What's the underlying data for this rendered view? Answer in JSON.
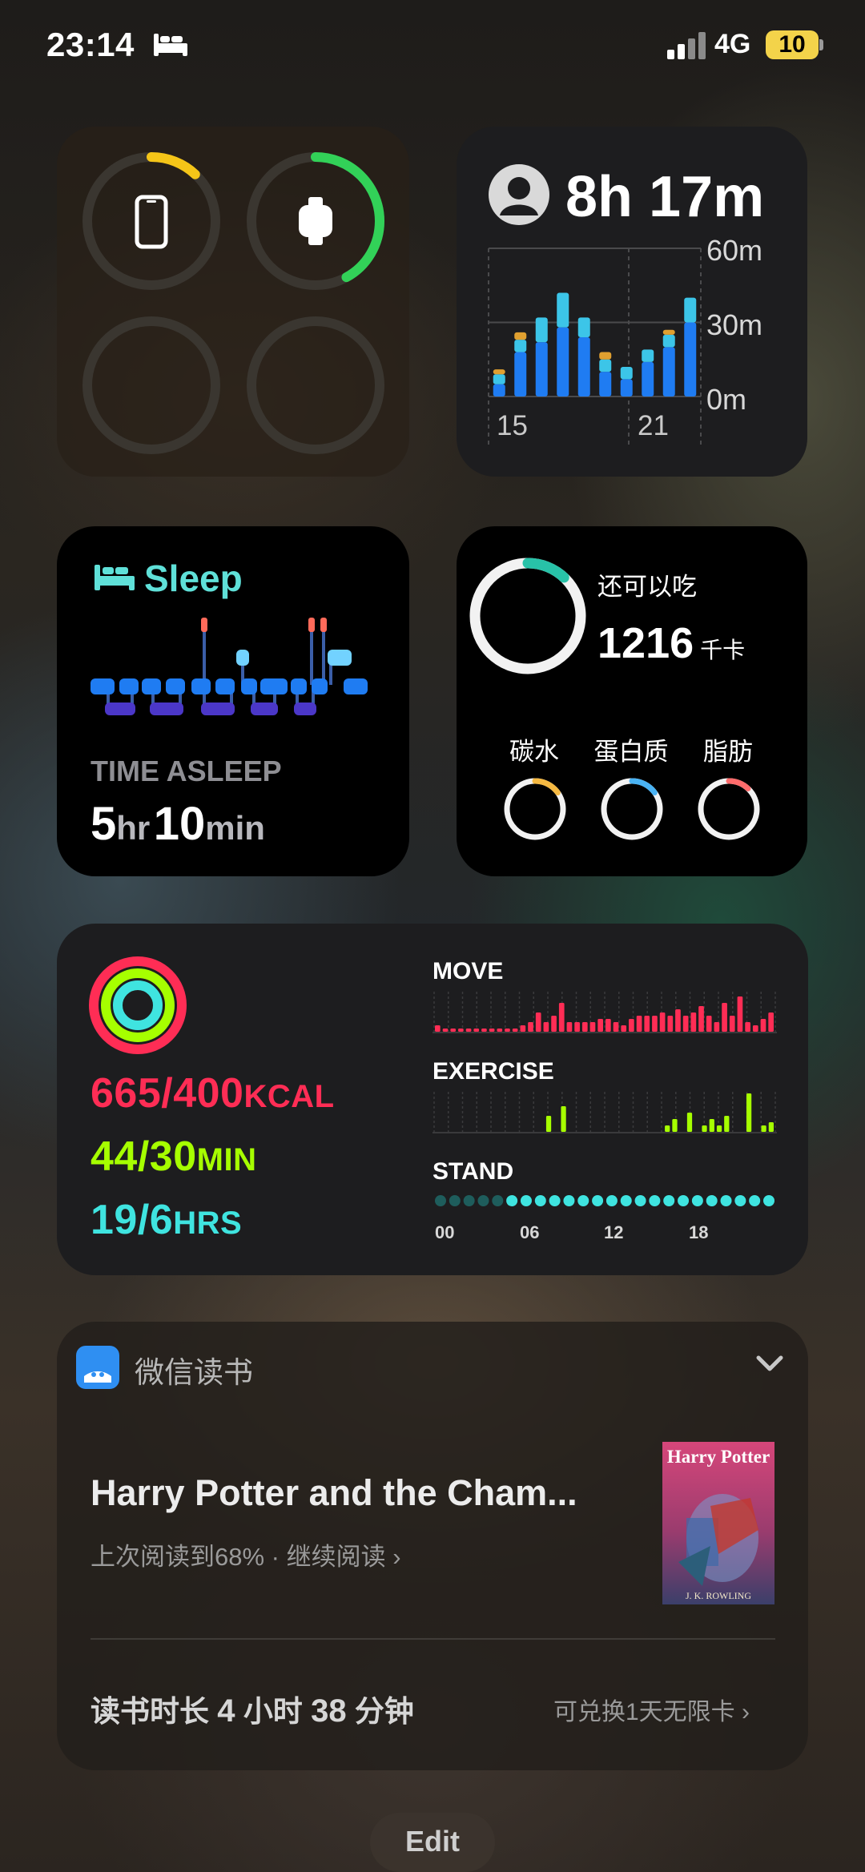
{
  "status_bar": {
    "time": "23:14",
    "network": "4G",
    "battery": "10",
    "sleep_focus_icon": "bed-icon"
  },
  "batteries_widget": {
    "devices": [
      {
        "name": "phone-icon",
        "level": 0.12,
        "color": "#f5c518"
      },
      {
        "name": "watch-icon",
        "level": 0.42,
        "color": "#32d158"
      },
      {
        "name": "empty",
        "level": 0
      },
      {
        "name": "empty",
        "level": 0
      }
    ]
  },
  "screen_time_widget": {
    "total": "8h 17m",
    "y_ticks": [
      "60m",
      "30m",
      "0m"
    ],
    "x_ticks": [
      "15",
      "21"
    ],
    "chart_data": {
      "type": "bar",
      "ylim": [
        0,
        60
      ],
      "series": [
        {
          "values": [
            5,
            18,
            22,
            28,
            24,
            10,
            7,
            14,
            20,
            30
          ]
        },
        {
          "values": [
            4,
            5,
            10,
            14,
            8,
            5,
            5,
            5,
            5,
            10
          ]
        },
        {
          "values": [
            2,
            3,
            0,
            0,
            0,
            3,
            0,
            0,
            2,
            0
          ]
        }
      ],
      "colors": [
        "#1f7cf2",
        "#3cc5e8",
        "#e0a030"
      ]
    }
  },
  "sleep_widget": {
    "title": "Sleep",
    "label": "TIME ASLEEP",
    "hours": "5",
    "hours_unit": "hr",
    "minutes": "10",
    "minutes_unit": "min",
    "stage_colors": {
      "awake": "#ff6a5a",
      "rem": "#72d2ff",
      "core": "#1f7cf2",
      "deep": "#4b37c8"
    }
  },
  "calorie_widget": {
    "label": "还可以吃",
    "value": "1216",
    "unit": "千卡",
    "ring_progress": 0.12,
    "macros": [
      {
        "name": "碳水",
        "color": "#f5b942",
        "progress": 0.15
      },
      {
        "name": "蛋白质",
        "color": "#4ab3f4",
        "progress": 0.15
      },
      {
        "name": "脂肪",
        "color": "#ff6b6b",
        "progress": 0.12
      }
    ]
  },
  "activity_widget": {
    "move": {
      "value": "665/400",
      "unit": "KCAL",
      "color": "#ff2d55"
    },
    "exercise": {
      "value": "44/30",
      "unit": "MIN",
      "color": "#a6ff00"
    },
    "stand": {
      "value": "19/6",
      "unit": "HRS",
      "color": "#3fe4e0"
    },
    "move_label": "MOVE",
    "exercise_label": "EXERCISE",
    "stand_label": "STAND",
    "hour_labels": [
      "00",
      "06",
      "12",
      "18"
    ],
    "chart_data": {
      "type": "bar",
      "series": [
        {
          "name": "MOVE",
          "values": [
            2,
            1,
            1,
            1,
            1,
            1,
            1,
            1,
            1,
            1,
            1,
            2,
            3,
            6,
            3,
            5,
            9,
            3,
            3,
            3,
            3,
            4,
            4,
            3,
            2,
            4,
            5,
            5,
            5,
            6,
            5,
            7,
            5,
            6,
            8,
            5,
            3,
            9,
            5,
            11,
            3,
            2,
            4,
            6
          ]
        },
        {
          "name": "EXERCISE",
          "values": [
            0,
            0,
            0,
            0,
            0,
            0,
            0,
            0,
            0,
            0,
            0,
            0,
            0,
            0,
            0,
            5,
            0,
            8,
            0,
            0,
            0,
            0,
            0,
            0,
            0,
            0,
            0,
            0,
            0,
            0,
            0,
            2,
            4,
            0,
            6,
            0,
            2,
            4,
            2,
            5,
            0,
            0,
            12,
            0,
            2,
            3
          ]
        },
        {
          "name": "STAND",
          "values": [
            0,
            0,
            0,
            0,
            0,
            1,
            1,
            1,
            1,
            1,
            1,
            1,
            1,
            1,
            1,
            1,
            1,
            1,
            1,
            1,
            1,
            1,
            1,
            1
          ]
        }
      ]
    }
  },
  "reader_widget": {
    "app_name": "微信读书",
    "book_title": "Harry Potter and the Cham...",
    "progress_text": "上次阅读到68% · 继续阅读",
    "read_time_prefix": "读书时长",
    "read_hours": "4",
    "hours_unit": "小时",
    "read_minutes": "38",
    "minutes_unit": "分钟",
    "redeem_text": "可兑换1天无限卡",
    "cover_title": "Harry Potter",
    "cover_author": "J. K. ROWLING"
  },
  "edit_label": "Edit"
}
